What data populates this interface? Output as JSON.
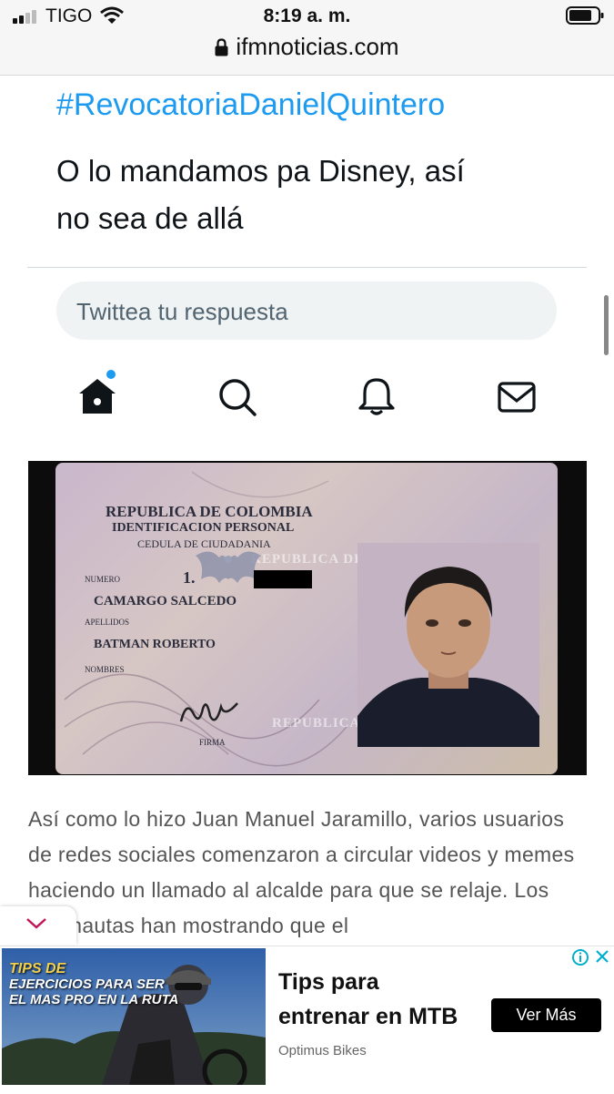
{
  "status_bar": {
    "carrier": "TIGO",
    "time": "8:19 a. m.",
    "url": "ifmnoticias.com"
  },
  "tweet": {
    "hashtag": "#RevocatoriaDanielQuintero",
    "text_line1": "O lo mandamos pa Disney, así",
    "text_line2": "no sea de allá",
    "reply_placeholder": "Twittea tu respuesta"
  },
  "nav_icons": [
    "home-icon",
    "search-icon",
    "notifications-icon",
    "messages-icon"
  ],
  "id_card": {
    "line1": "REPUBLICA DE COLOMBIA",
    "line2": "IDENTIFICACION PERSONAL",
    "line3": "CEDULA DE CIUDADANIA",
    "numero_label": "NUMERO",
    "numero_value": "1.",
    "surname": "CAMARGO SALCEDO",
    "apellidos_label": "APELLIDOS",
    "given_names": "BATMAN ROBERTO",
    "nombres_label": "NOMBRES",
    "firma_label": "FIRMA",
    "watermark1": "REPUBLICA DE COLOMBIA",
    "watermark2": "REPUBLICA DE COLOMBIA"
  },
  "article": {
    "paragraph": "Así como lo hizo Juan Manuel Jaramillo, varios usuarios de redes sociales comenzaron a circular videos y memes haciendo un llamado al alcalde para que se relaje. Los internautas han mostrando que el"
  },
  "ad": {
    "image_line1": "TIPS DE",
    "image_line2": "EJERCICIOS PARA SER",
    "image_line3": "EL MAS PRO EN LA RUTA",
    "headline_line1": "Tips para",
    "headline_line2": "entrenar en MTB",
    "source": "Optimus Bikes",
    "cta": "Ver Más"
  },
  "colors": {
    "twitter_blue": "#1d9bf0",
    "statusbar_bg": "#f6f6f6",
    "ad_cta_bg": "#000000",
    "ad_badge": "#00aecd"
  }
}
